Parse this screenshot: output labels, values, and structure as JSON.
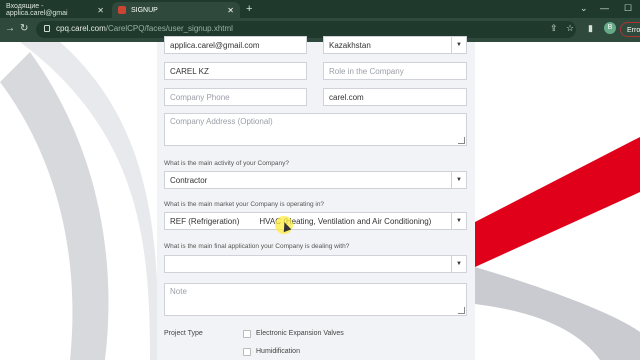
{
  "browser": {
    "tabs": [
      {
        "title": "Входящие - applica.carel@gmai"
      },
      {
        "title": "SIGNUP"
      }
    ],
    "new_tab": "+",
    "url_host": "cpq.carel.com",
    "url_path": "/CarelCPQ/faces/user_signup.xhtml",
    "profile_letter": "B",
    "error_label": "Error",
    "window_controls": [
      "—",
      "☐"
    ]
  },
  "form": {
    "email_value": "applica.carel@gmail.com",
    "country_value": "Kazakhstan",
    "company_name_value": "CAREL KZ",
    "role_placeholder": "Role in the Company",
    "company_phone_placeholder": "Company Phone",
    "website_value": "carel.com",
    "company_address_placeholder": "Company Address  (Optional)",
    "q_main_activity": "What is the main activity of your Company?",
    "main_activity_value": "Contractor",
    "q_main_market": "What is the main market your Company is operating in?",
    "main_market_value_1": "REF (Refrigeration)",
    "main_market_value_2": "HVAC (Heating, Ventilation and Air Conditioning)",
    "q_final_application": "What is the main final application your Company is dealing with?",
    "final_application_value": "",
    "note_placeholder": "Note",
    "project_type_label": "Project Type",
    "project_types": [
      {
        "label": "Electronic Expansion Valves",
        "checked": false
      },
      {
        "label": "Humidification",
        "checked": false
      }
    ]
  },
  "colors": {
    "tab_bar": "#1f3a2c",
    "toolbar": "#2f4a3c",
    "accent_red": "#e0001a",
    "panel_bg": "#f2f3f6"
  }
}
